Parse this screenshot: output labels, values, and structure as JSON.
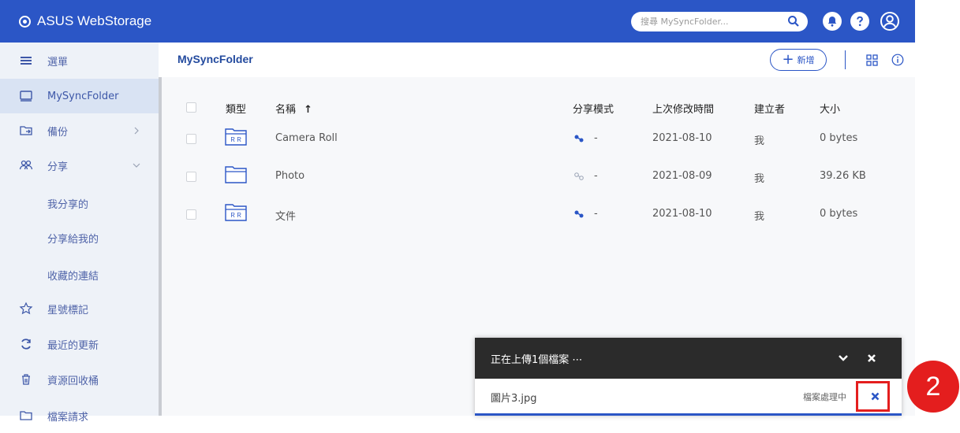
{
  "header": {
    "brand": "ASUS WebStorage",
    "search_placeholder": "搜尋 MySyncFolder..."
  },
  "sidebar": {
    "menu_label": "選單",
    "items": [
      {
        "label": "MySyncFolder",
        "icon": "folder-sync-icon"
      },
      {
        "label": "備份",
        "icon": "backup-icon"
      },
      {
        "label": "分享",
        "icon": "share-people-icon"
      },
      {
        "label": "我分享的"
      },
      {
        "label": "分享給我的"
      },
      {
        "label": "收藏的連結"
      },
      {
        "label": "星號標記",
        "icon": "star-icon"
      },
      {
        "label": "最近的更新",
        "icon": "refresh-icon"
      },
      {
        "label": "資源回收桶",
        "icon": "trash-icon"
      },
      {
        "label": "檔案請求",
        "icon": "file-request-icon"
      }
    ]
  },
  "content": {
    "breadcrumb": "MySyncFolder",
    "new_label": "新增",
    "columns": {
      "type": "類型",
      "name": "名稱",
      "share": "分享模式",
      "modified": "上次修改時間",
      "creator": "建立者",
      "size": "大小"
    },
    "files": [
      {
        "name": "Camera Roll",
        "share": "-",
        "modified": "2021-08-10",
        "creator": "我",
        "size": "0 bytes"
      },
      {
        "name": "Photo",
        "share": "-",
        "modified": "2021-08-09",
        "creator": "我",
        "size": "39.26 KB"
      },
      {
        "name": "文件",
        "share": "-",
        "modified": "2021-08-10",
        "creator": "我",
        "size": "0 bytes"
      }
    ]
  },
  "upload": {
    "title": "正在上傳1個檔案 ⋯",
    "file_name": "圖片3.jpg",
    "status": "檔案處理中",
    "progress_percent": 100
  },
  "annotation": {
    "step": "2"
  },
  "colors": {
    "brand_blue": "#2b56c6",
    "highlight_red": "#e41e1e",
    "panel_dark": "#2b2b2b"
  }
}
